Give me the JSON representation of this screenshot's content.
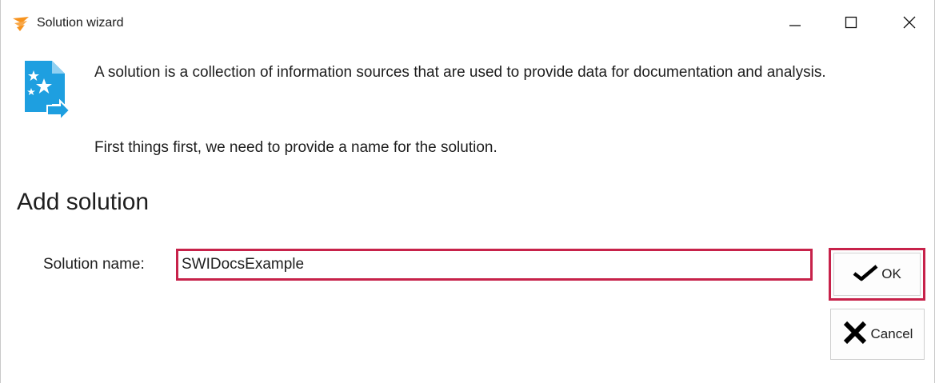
{
  "window": {
    "title": "Solution wizard",
    "app_icon": "solarwinds-flame-icon",
    "controls": [
      "minimize-icon",
      "maximize-icon",
      "close-icon"
    ]
  },
  "info": {
    "icon": "solution-document-stars-icon",
    "paragraph1": "A solution is a collection of information sources that are used to provide data for documentation and analysis.",
    "paragraph2": "First things first, we need to provide a name for the solution."
  },
  "form": {
    "section_title": "Add solution",
    "name_label": "Solution name:",
    "name_value": "SWIDocsExample",
    "ok_label": "OK",
    "cancel_label": "Cancel"
  },
  "colors": {
    "highlight_border": "#c7224a",
    "icon_blue": "#1e9fe0",
    "flame_orange": "#f7931e"
  }
}
